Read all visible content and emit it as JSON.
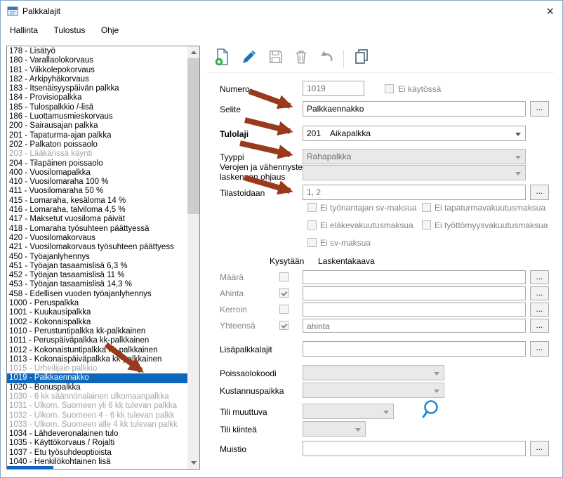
{
  "window": {
    "title": "Palkkalajit",
    "close_glyph": "×"
  },
  "menu": {
    "items": [
      "Hallinta",
      "Tulostus",
      "Ohje"
    ]
  },
  "toolbar": {
    "buttons": [
      "new-record",
      "edit",
      "save",
      "delete",
      "undo",
      "copy"
    ]
  },
  "colors": {
    "selection_blue": "#0d67bd",
    "annotation_arrow": "#993a1d",
    "edit_pen_blue": "#1d6fbe",
    "lookup_blue": "#1d87d8"
  },
  "list": {
    "items": [
      {
        "label": "178 - Lisätyö",
        "state": "normal"
      },
      {
        "label": "180 - Varallaolokorvaus",
        "state": "normal"
      },
      {
        "label": "181 - Viikkolepokorvaus",
        "state": "normal"
      },
      {
        "label": "182 - Arkipyhäkorvaus",
        "state": "normal"
      },
      {
        "label": "183 - Itsenäisyyspäivän palkka",
        "state": "normal"
      },
      {
        "label": "184 - Provisiopalkka",
        "state": "normal"
      },
      {
        "label": "185 - Tulospalkkio /-lisä",
        "state": "normal"
      },
      {
        "label": "186 - Luottamusmieskorvaus",
        "state": "normal"
      },
      {
        "label": "200 - Sairausajan palkka",
        "state": "normal"
      },
      {
        "label": "201 - Tapaturma-ajan palkka",
        "state": "normal"
      },
      {
        "label": "202 - Palkaton poissaolo",
        "state": "normal"
      },
      {
        "label": "203 - Lääkärissä käynti",
        "state": "disabled"
      },
      {
        "label": "204 - Tilapäinen poissaolo",
        "state": "normal"
      },
      {
        "label": "400 - Vuosilomapalkka",
        "state": "normal"
      },
      {
        "label": "410 - Vuosilomaraha 100 %",
        "state": "normal"
      },
      {
        "label": "411 - Vuosilomaraha 50 %",
        "state": "normal"
      },
      {
        "label": "415 - Lomaraha, kesäloma 14 %",
        "state": "normal"
      },
      {
        "label": "416 - Lomaraha, talviloma 4,5 %",
        "state": "normal"
      },
      {
        "label": "417 - Maksetut vuosiloma päivät",
        "state": "normal"
      },
      {
        "label": "418 - Lomaraha työsuhteen päättyessä",
        "state": "normal"
      },
      {
        "label": "420 - Vuosilomakorvaus",
        "state": "normal"
      },
      {
        "label": "421 - Vuosilomakorvaus työsuhteen päättyess",
        "state": "normal"
      },
      {
        "label": "450 - Työajanlyhennys",
        "state": "normal"
      },
      {
        "label": "451 - Työajan tasaamislisä 6,3 %",
        "state": "normal"
      },
      {
        "label": "452 - Työajan tasaamislisä 11 %",
        "state": "normal"
      },
      {
        "label": "453 - Työajan tasaamislisä 14,3 %",
        "state": "normal"
      },
      {
        "label": "458 - Edellisen vuoden työajanlyhennys",
        "state": "normal"
      },
      {
        "label": "1000 - Peruspalkka",
        "state": "normal"
      },
      {
        "label": "1001 - Kuukausipalkka",
        "state": "normal"
      },
      {
        "label": "1002 - Kokonaispalkka",
        "state": "normal"
      },
      {
        "label": "1010 - Perustuntipalkka kk-palkkainen",
        "state": "normal"
      },
      {
        "label": "1011 - Peruspäiväpalkka kk-palkkainen",
        "state": "normal"
      },
      {
        "label": "1012 - Kokonaistuntipalkka kk-palkkainen",
        "state": "normal"
      },
      {
        "label": "1013 - Kokonaispäiväpalkka kk-palkkainen",
        "state": "normal"
      },
      {
        "label": "1015 - Urheilijain palkkio",
        "state": "disabled"
      },
      {
        "label": "1019 - Palkkaennakko",
        "state": "selected"
      },
      {
        "label": "1020 - Bonuspalkka",
        "state": "normal"
      },
      {
        "label": "1030 - 6 kk säännönalainen ulkomaanpalkka",
        "state": "disabled"
      },
      {
        "label": "1031 - Ulkom. Suomeen yli 6 kk tulevan palkka",
        "state": "disabled"
      },
      {
        "label": "1032 - Ulkom. Suomeen 4 - 6 kk tulevan palkk",
        "state": "disabled"
      },
      {
        "label": "1033 - Ulkom. Suomeen alle 4 kk tulevan palkk",
        "state": "disabled"
      },
      {
        "label": "1034 - Lähdeveronalainen tulo",
        "state": "normal"
      },
      {
        "label": "1035 - Käyttökorvaus / Rojalti",
        "state": "normal"
      },
      {
        "label": "1037 - Etu työsuhdeoptioista",
        "state": "normal"
      },
      {
        "label": "1040 - Henkilökohtainen lisä",
        "state": "normal"
      }
    ]
  },
  "form": {
    "numero_label": "Numero",
    "numero_value": "1019",
    "ei_kaytossa_label": "Ei käytössä",
    "selite_label": "Selite",
    "selite_value": "Palkkaennakko",
    "tulolaji_label": "Tulolaji",
    "tulolaji_code": "201",
    "tulolaji_value": "Aikapalkka",
    "tyyppi_label": "Tyyppi",
    "tyyppi_value": "Rahapalkka",
    "verojen_label_line1": "Verojen ja vähennysten",
    "verojen_label_line2": "laskennan ohjaus",
    "tilastoidaan_label": "Tilastoidaan",
    "tilastoidaan_value": "1, 2",
    "sv_checkboxes": [
      "Ei työnantajan sv-maksua",
      "Ei tapaturmavakuutusmaksua",
      "Ei eläkevakuutusmaksua",
      "Ei työttömyysvakuutusmaksua",
      "Ei sv-maksua"
    ],
    "kysytaan_header": "Kysytään",
    "laskentakaava_header": "Laskentakaava",
    "kaava_rows": [
      {
        "label": "Määrä",
        "checked": false,
        "value": ""
      },
      {
        "label": "Ahinta",
        "checked": true,
        "value": ""
      },
      {
        "label": "Kerroin",
        "checked": false,
        "value": ""
      },
      {
        "label": "Yhteensä",
        "checked": true,
        "value": "ahinta"
      }
    ],
    "lisapalkkalajit_label": "Lisäpalkkalajit",
    "poissaolokoodi_label": "Poissaolokoodi",
    "kustannuspaikka_label": "Kustannuspaikka",
    "tili_muuttuva_label": "Tili muuttuva",
    "tili_kiintea_label": "Tili kiinteä",
    "muistio_label": "Muistio",
    "ellipsis": "..."
  }
}
